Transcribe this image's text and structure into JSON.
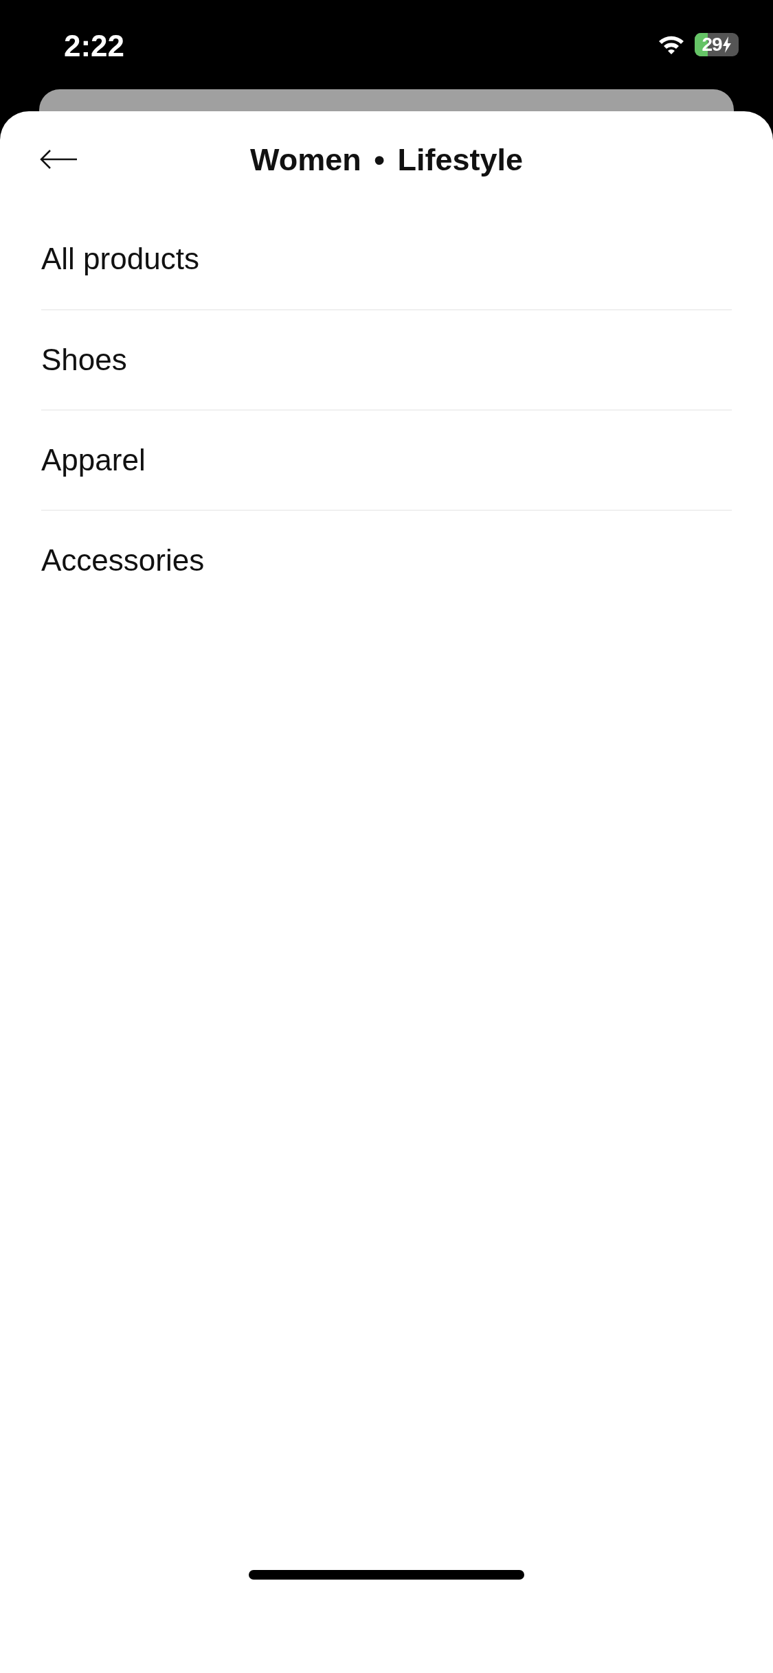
{
  "status_bar": {
    "time": "2:22",
    "battery": "29"
  },
  "header": {
    "title": "Women • Lifestyle"
  },
  "items": [
    {
      "label": "All products"
    },
    {
      "label": "Shoes"
    },
    {
      "label": "Apparel"
    },
    {
      "label": "Accessories"
    }
  ]
}
